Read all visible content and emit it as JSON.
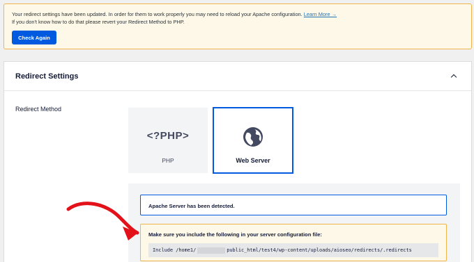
{
  "notice": {
    "line1": "Your redirect settings have been updated. In order for them to work properly you may need to reload your Apache configuration.",
    "learn_more": "Learn More →",
    "line2": "If you don't know how to do that please revert your Redirect Method to PHP.",
    "button_label": "Check Again"
  },
  "card": {
    "title": "Redirect Settings",
    "field_label": "Redirect Method",
    "options": [
      {
        "logo": "<?PHP>",
        "label": "PHP",
        "selected": false
      },
      {
        "logo": "globe-icon",
        "label": "Web Server",
        "selected": true
      }
    ]
  },
  "apache": {
    "detected": "Apache Server has been detected.",
    "include_title": "Make sure you include the following in your server configuration file:",
    "code_prefix": "Include /home1/",
    "code_suffix": "public_html/test4/wp-content/uploads/aioseo/redirects/.redirects"
  },
  "colors": {
    "accent": "#005ae0",
    "warning_border": "#f1b44d",
    "annotation_arrow": "#e3121a"
  }
}
